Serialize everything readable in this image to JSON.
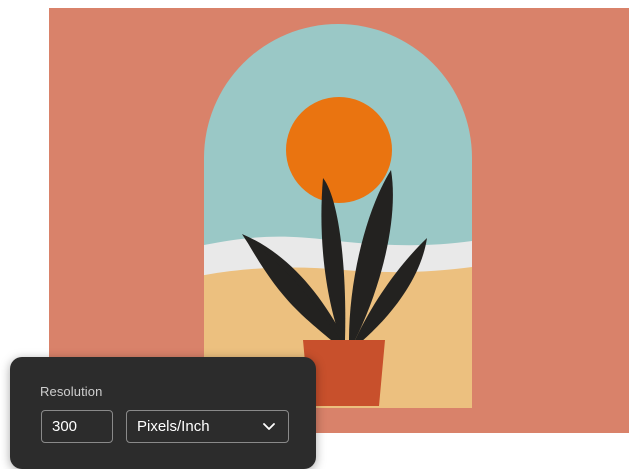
{
  "colors": {
    "background": "#d9826a",
    "sky": "#9ac8c6",
    "sun": "#ea7410",
    "water": "#e9e9e9",
    "sand": "#ecc07f",
    "leaf": "#232220",
    "pot": "#c8502c",
    "panel_bg": "#2c2c2c",
    "panel_text": "#cfcfcf",
    "control_border": "#8a8a8a",
    "control_text": "#ffffff"
  },
  "resolution_panel": {
    "label": "Resolution",
    "value": "300",
    "unit": {
      "selected": "Pixels/Inch",
      "icon": "chevron-down-icon"
    }
  }
}
